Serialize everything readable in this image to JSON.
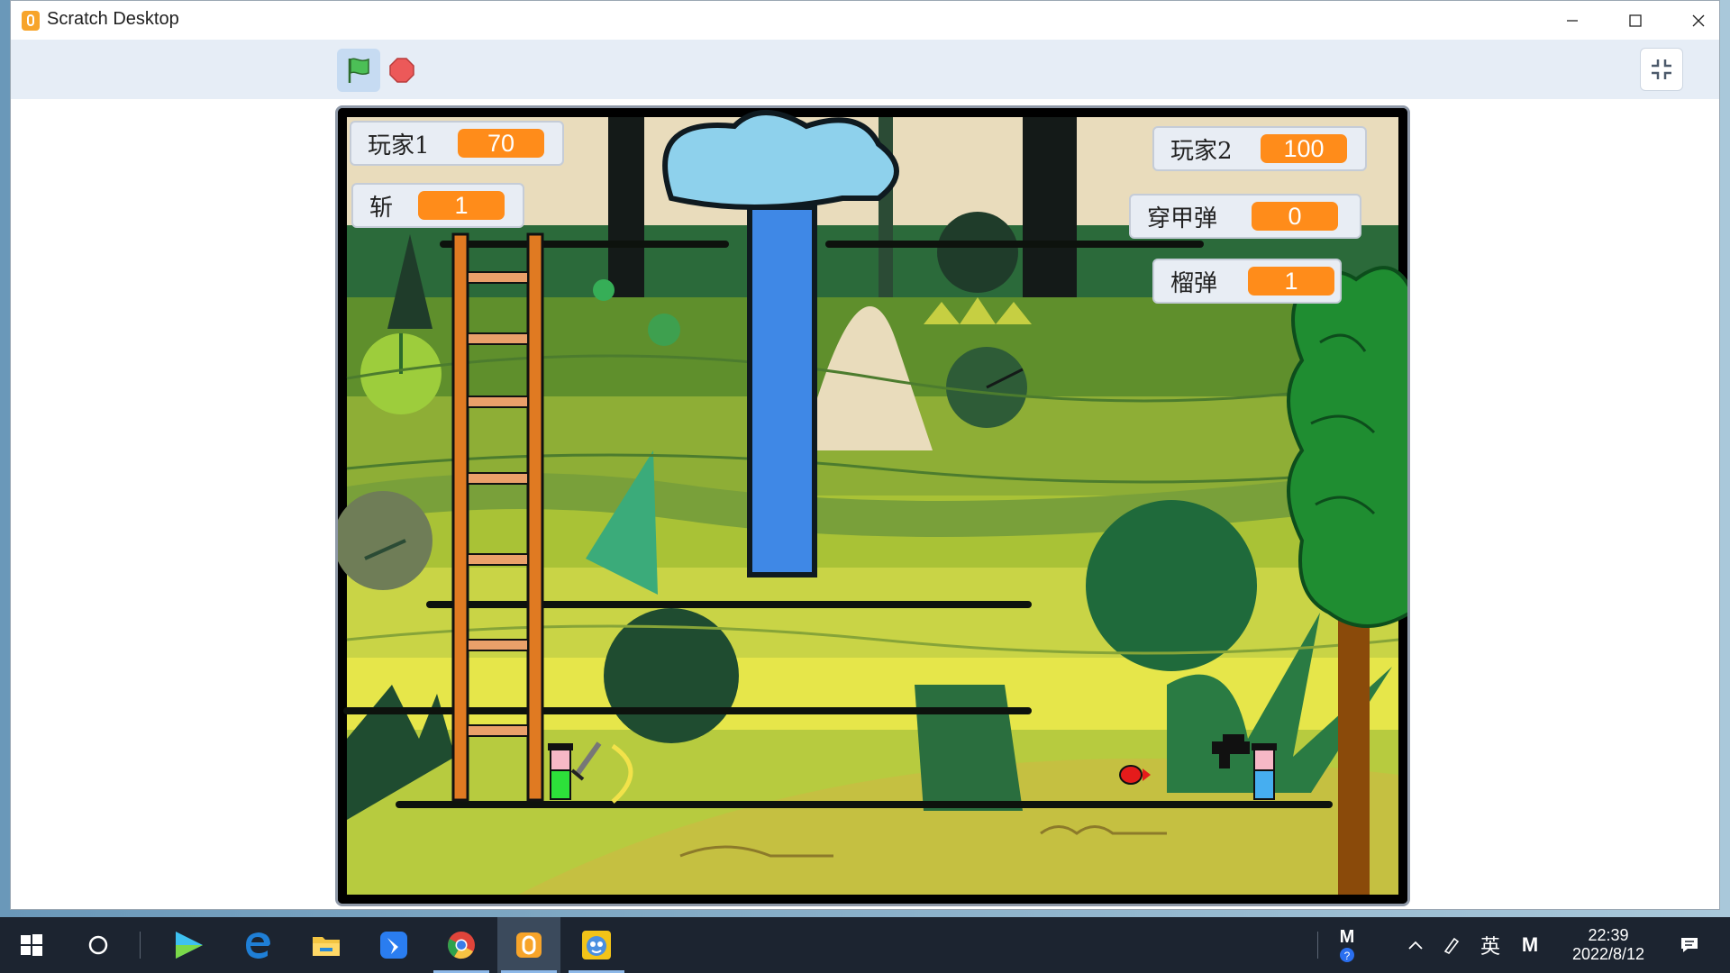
{
  "window": {
    "title": "Scratch Desktop",
    "controls": [
      "minimize",
      "maximize",
      "close"
    ]
  },
  "toolbar": {
    "green_flag_icon": "green-flag-icon",
    "stop_icon": "stop-sign-icon",
    "exit_fullscreen_icon": "exit-fullscreen-icon"
  },
  "monitors": {
    "player1": {
      "label": "玩家1",
      "value": "70"
    },
    "slash": {
      "label": "斩",
      "value": "1"
    },
    "player2": {
      "label": "玩家2",
      "value": "100"
    },
    "ap_bullet": {
      "label": "穿甲弹",
      "value": "0"
    },
    "grenade": {
      "label": "榴弹",
      "value": "1"
    }
  },
  "taskbar": {
    "time": "22:39",
    "date": "2022/8/12",
    "ime": "英",
    "apps": [
      "start",
      "search",
      "media-player",
      "edge",
      "file-explorer",
      "feishu",
      "chrome",
      "scratch",
      "game"
    ]
  },
  "colors": {
    "monitor_value": "#ff8c1a",
    "toolbar_bg": "#e6edf6",
    "taskbar_bg": "#1c2430"
  }
}
